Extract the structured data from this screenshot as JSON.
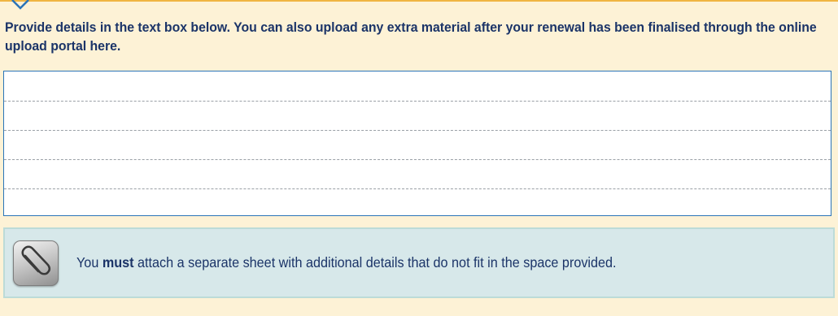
{
  "instruction": {
    "text": "Provide details in the text box below. You can also upload any extra material after your renewal has been finalised through the online upload portal here."
  },
  "details_box": {
    "value": ""
  },
  "note": {
    "icon": "paperclip-icon",
    "text_before": "You ",
    "text_emphasis": "must",
    "text_after": " attach a separate sheet with additional details that do not fit in the space provided."
  },
  "colors": {
    "page_background": "#fdf2d6",
    "accent_rule": "#f0b542",
    "text": "#1b3468",
    "textbox_border": "#2b74b8",
    "note_background": "#d7e8ea"
  }
}
